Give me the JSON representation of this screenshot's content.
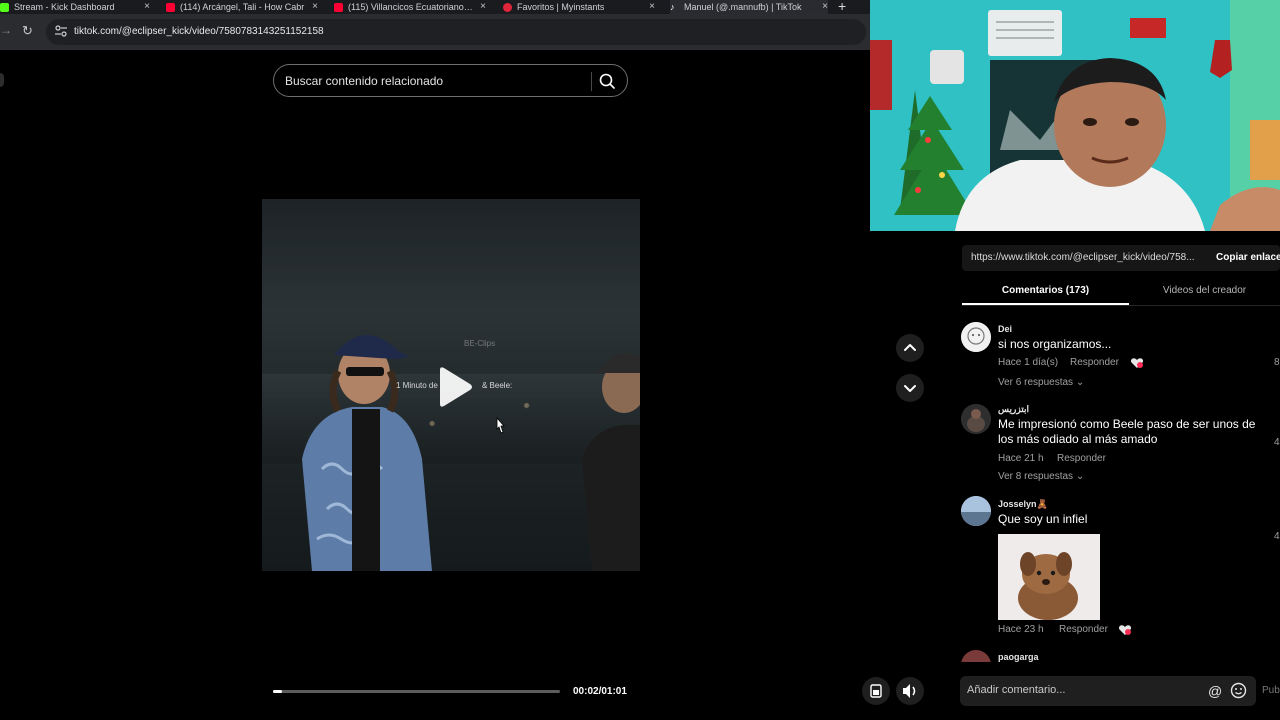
{
  "browser": {
    "tabs": [
      {
        "title": "Stream - Kick Dashboard",
        "favicon_color": "#53fc18",
        "active": false
      },
      {
        "title": "(114) Arcángel, Tali - How Cabr",
        "favicon_color": "#ff0033",
        "active": false
      },
      {
        "title": "(115) Villancicos Ecuatorianos M",
        "favicon_color": "#ff0033",
        "active": false
      },
      {
        "title": "Favoritos | Myinstants",
        "favicon_color": "#e0243a",
        "active": false
      },
      {
        "title": "Manuel (@.mannufb) | TikTok",
        "favicon_color": "#ffffff",
        "active": true
      }
    ],
    "new_tab_label": "+",
    "close_glyph": "×",
    "url": "tiktok.com/@eclipser_kick/video/7580783143251152158"
  },
  "player": {
    "search_placeholder": "Buscar contenido relacionado",
    "watermark": "BE-Clips",
    "caption_left": "1 Minuto de",
    "caption_right": "& Beele:",
    "progress": 0.03,
    "time": "00:02/01:01"
  },
  "share": {
    "url": "https://www.tiktok.com/@eclipser_kick/video/758...",
    "copy_label": "Copiar enlace"
  },
  "tabs": {
    "comments": "Comentarios (173)",
    "creator_videos": "Videos del creador"
  },
  "comments": [
    {
      "user": "Dei",
      "text": "si nos organizamos...",
      "time": "Hace 1 día(s)",
      "reply": "Responder",
      "more": "Ver 6 respuestas",
      "likes": "8"
    },
    {
      "user": "ابتزريس",
      "text": "Me impresionó como Beele paso de ser unos de los más odiado al más amado",
      "time": "Hace 21 h",
      "reply": "Responder",
      "more": "Ver 8 respuestas",
      "likes": "4"
    },
    {
      "user": "Josselyn🧸",
      "text": "Que soy un infiel",
      "time": "Hace 23 h",
      "reply": "Responder",
      "likes": "4"
    },
    {
      "user": "paogarga"
    }
  ],
  "compose": {
    "placeholder": "Añadir comentario...",
    "at_symbol": "@",
    "post_label": "Publicar"
  },
  "icons": [
    "search-icon",
    "play-icon",
    "chevron-up-icon",
    "chevron-down-icon",
    "captions-icon",
    "volume-icon",
    "emoji-icon",
    "heart-icon",
    "reload-icon"
  ],
  "colors": {
    "accent_tiktok": "#fe2c55",
    "page_bg": "#000000",
    "panel_bg": "#161616"
  }
}
